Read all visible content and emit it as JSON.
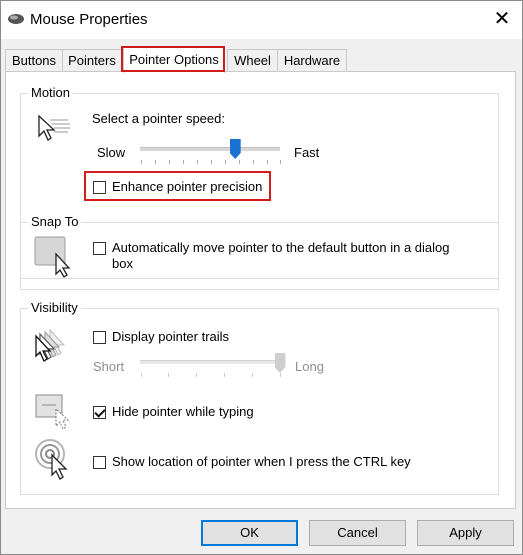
{
  "window": {
    "title": "Mouse Properties",
    "close_glyph": "✕"
  },
  "tabs": [
    {
      "label": "Buttons"
    },
    {
      "label": "Pointers"
    },
    {
      "label": "Pointer Options"
    },
    {
      "label": "Wheel"
    },
    {
      "label": "Hardware"
    }
  ],
  "active_tab": "Pointer Options",
  "motion": {
    "group_label": "Motion",
    "speed_prompt": "Select a pointer speed:",
    "slow_label": "Slow",
    "fast_label": "Fast",
    "speed_level": 0.68,
    "precision_label": "Enhance pointer precision",
    "precision_checked": false
  },
  "snap_to": {
    "group_label": "Snap To",
    "snap_label_line1": "Automatically move pointer to the default button in a dialog",
    "snap_label_line2": "box",
    "snap_checked": false
  },
  "visibility": {
    "group_label": "Visibility",
    "trails_label": "Display pointer trails",
    "trails_checked": false,
    "short_label": "Short",
    "long_label": "Long",
    "trail_level": 1.0,
    "hide_label": "Hide pointer while typing",
    "hide_checked": true,
    "ctrl_label": "Show location of pointer when I press the CTRL key",
    "ctrl_checked": false
  },
  "buttons": {
    "ok": "OK",
    "cancel": "Cancel",
    "apply": "Apply"
  },
  "colors": {
    "highlight": "#d21c1c",
    "accent": "#0078d7",
    "thumb": "#1a73d1"
  }
}
